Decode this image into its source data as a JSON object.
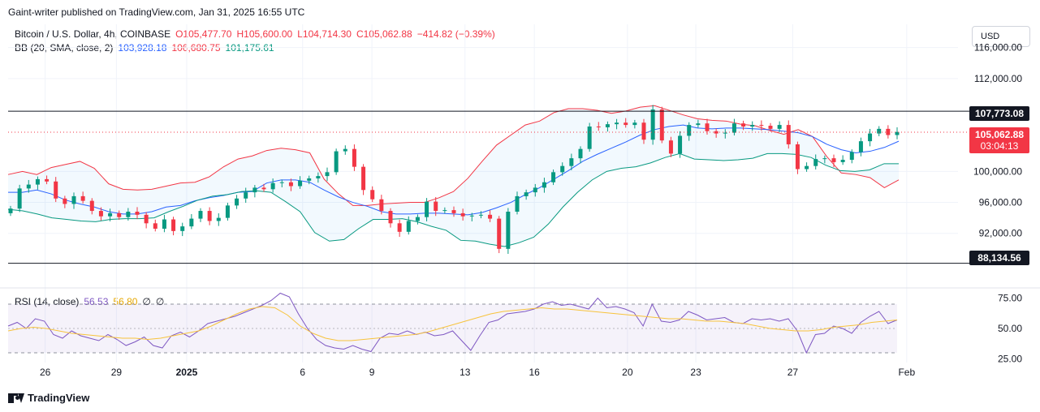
{
  "publisher": "Gaint-writer published on TradingView.com, Jan 31, 2025 16:55 UTC",
  "currency_button": "USD",
  "legend": {
    "symbol": "Bitcoin / U.S. Dollar, 4h, COINBASE",
    "open": "O105,477.70",
    "high": "H105,600.00",
    "low": "L104,714.30",
    "close": "C105,062.88",
    "change": "−414.82 (−0.39%)",
    "bb_label": "BB (20, SMA, close, 2)",
    "bb_basis": "103,928.18",
    "bb_upper": "106,680.75",
    "bb_lower": "101,175.61",
    "rsi_label": "RSI (14, close)",
    "rsi_value": "56.53",
    "rsi_ma": "56.80",
    "rsi_x1": "∅",
    "rsi_x2": "∅"
  },
  "price_tags": {
    "resistance": "107,773.08",
    "last_price": "105,062.88",
    "countdown": "03:04:13",
    "support": "88,134.56"
  },
  "brand": "TradingView",
  "colors": {
    "up": "#089981",
    "down": "#f23645",
    "bb_upper": "#f23645",
    "bb_basis": "#2962ff",
    "bb_lower": "#089981",
    "rsi": "#7e57c2",
    "rsi_ma": "#f7c33c",
    "level_line": "#131722"
  },
  "chart_data": [
    {
      "type": "candlestick",
      "title": "Bitcoin / U.S. Dollar, 4h, COINBASE",
      "y_axis_ticks": [
        "116,000.00",
        "112,000.00",
        "100,000.00",
        "96,000.00",
        "92,000.00"
      ],
      "ylim": [
        86000,
        119000
      ],
      "x_axis_ticks": [
        "26",
        "29",
        "2025",
        "6",
        "9",
        "13",
        "16",
        "20",
        "23",
        "27",
        "Feb"
      ],
      "horizontal_levels": [
        107773.08,
        88134.56
      ],
      "last_price": 105062.88,
      "closes": [
        95200,
        97800,
        98300,
        99000,
        98700,
        96500,
        95800,
        96800,
        96200,
        94900,
        94200,
        94600,
        94100,
        94800,
        94400,
        93300,
        92600,
        93800,
        92300,
        92900,
        93900,
        94900,
        93600,
        94000,
        95600,
        96500,
        97300,
        97900,
        97700,
        98500,
        98600,
        98100,
        98800,
        99100,
        99400,
        99900,
        102600,
        102900,
        100600,
        97600,
        96400,
        94900,
        93300,
        92200,
        93600,
        94100,
        96100,
        94900,
        95000,
        94600,
        94200,
        94300,
        94400,
        93900,
        90000,
        94800,
        96800,
        97300,
        97900,
        98600,
        99900,
        100700,
        101700,
        102900,
        105800,
        105700,
        106100,
        106300,
        106000,
        106300,
        104100,
        108000,
        104000,
        102300,
        104600,
        106000,
        106200,
        105200,
        104900,
        105000,
        106200,
        105800,
        106000,
        105900,
        105500,
        106000,
        103500,
        100300,
        100700,
        101600,
        101700,
        101200,
        101500,
        102500,
        103900,
        104900,
        105500,
        104700,
        105100
      ],
      "series": [
        {
          "name": "BB (20, SMA, close, 2) upper",
          "values": [
            99600,
            100000,
            99600,
            100500,
            100900,
            101300,
            100400,
            98400,
            97700,
            97600,
            97700,
            98100,
            98500,
            98600,
            99300,
            100600,
            101600,
            102000,
            102700,
            103000,
            102800,
            102400,
            99000,
            97100,
            95600,
            95600,
            95800,
            95900,
            96000,
            96000,
            96600,
            97400,
            99100,
            101300,
            103400,
            104700,
            106000,
            106500,
            107600,
            108100,
            108100,
            107900,
            107500,
            107800,
            108300,
            108500,
            107900,
            107300,
            106800,
            106600,
            106500,
            106100,
            105900,
            105300,
            104800,
            105400,
            104500,
            101900,
            99800,
            99600,
            99200,
            97900,
            98900
          ],
          "note": "upper band ~ series values are approximate"
        },
        {
          "name": "BB (20, SMA, close, 2) basis",
          "values": [
            97300,
            97300,
            97600,
            97100,
            96300,
            95800,
            95400,
            94800,
            94500,
            94500,
            94800,
            95400,
            95600,
            96200,
            96600,
            96900,
            97300,
            97400,
            98500,
            98900,
            98900,
            98600,
            97600,
            96700,
            96000,
            95500,
            94800,
            94500,
            94500,
            94600,
            94600,
            94500,
            94400,
            94700,
            95300,
            96000,
            97000,
            97900,
            99000,
            100100,
            101300,
            102200,
            103000,
            103800,
            104700,
            105400,
            105800,
            106000,
            105600,
            105500,
            105600,
            105600,
            105500,
            105400,
            105200,
            105000,
            104500,
            103500,
            102800,
            102400,
            102600,
            103100,
            103900
          ]
        },
        {
          "name": "BB (20, SMA, close, 2) lower",
          "values": [
            95100,
            94900,
            94500,
            94000,
            93800,
            93600,
            93500,
            93800,
            93900,
            93900,
            94000,
            94800,
            95500,
            96300,
            96800,
            97000,
            97400,
            97500,
            97300,
            96100,
            94800,
            92100,
            91000,
            91200,
            92600,
            93800,
            93800,
            93900,
            93500,
            92900,
            92400,
            91100,
            91000,
            90600,
            90300,
            90800,
            91500,
            93200,
            95400,
            97300,
            98900,
            100000,
            100400,
            100600,
            101100,
            101800,
            102300,
            101600,
            101500,
            101400,
            101500,
            101700,
            102300,
            102300,
            102200,
            101800,
            100800,
            100100,
            100000,
            100200,
            101000,
            101000
          ]
        }
      ]
    },
    {
      "type": "line",
      "title": "RSI (14, close)",
      "y_axis_ticks": [
        "75.00",
        "50.00",
        "25.00"
      ],
      "ylim": [
        22,
        80
      ],
      "bands": [
        70,
        50,
        30
      ],
      "series": [
        {
          "name": "RSI",
          "values": [
            52,
            55,
            50,
            58,
            56,
            45,
            42,
            48,
            44,
            42,
            40,
            45,
            41,
            36,
            39,
            43,
            36,
            34,
            44,
            47,
            43,
            48,
            54,
            56,
            58,
            60,
            63,
            66,
            69,
            73,
            79,
            76,
            62,
            50,
            41,
            36,
            34,
            33,
            36,
            33,
            31,
            42,
            46,
            45,
            48,
            45,
            47,
            44,
            45,
            48,
            40,
            32,
            44,
            55,
            57,
            62,
            63,
            64,
            66,
            70,
            72,
            69,
            70,
            68,
            66,
            75,
            67,
            68,
            66,
            63,
            52,
            70,
            56,
            55,
            57,
            64,
            61,
            57,
            58,
            59,
            55,
            54,
            58,
            57,
            58,
            56,
            58,
            48,
            30,
            45,
            46,
            52,
            50,
            46,
            55,
            60,
            64,
            54,
            57
          ]
        },
        {
          "name": "RSI MA",
          "values": [
            48,
            50,
            51,
            50,
            48,
            46,
            45,
            44,
            43,
            42,
            42,
            41,
            42,
            44,
            46,
            48,
            52,
            57,
            62,
            66,
            68,
            67,
            61,
            52,
            46,
            42,
            40,
            40,
            41,
            42,
            43,
            44,
            45,
            47,
            50,
            53,
            56,
            59,
            62,
            64,
            65,
            66,
            67,
            66,
            66,
            65,
            64,
            63,
            62,
            61,
            60,
            59,
            58,
            58,
            57,
            56,
            56,
            55,
            54,
            52,
            50,
            49,
            48,
            48,
            49,
            51,
            52,
            53,
            55,
            56,
            57
          ]
        }
      ]
    }
  ]
}
